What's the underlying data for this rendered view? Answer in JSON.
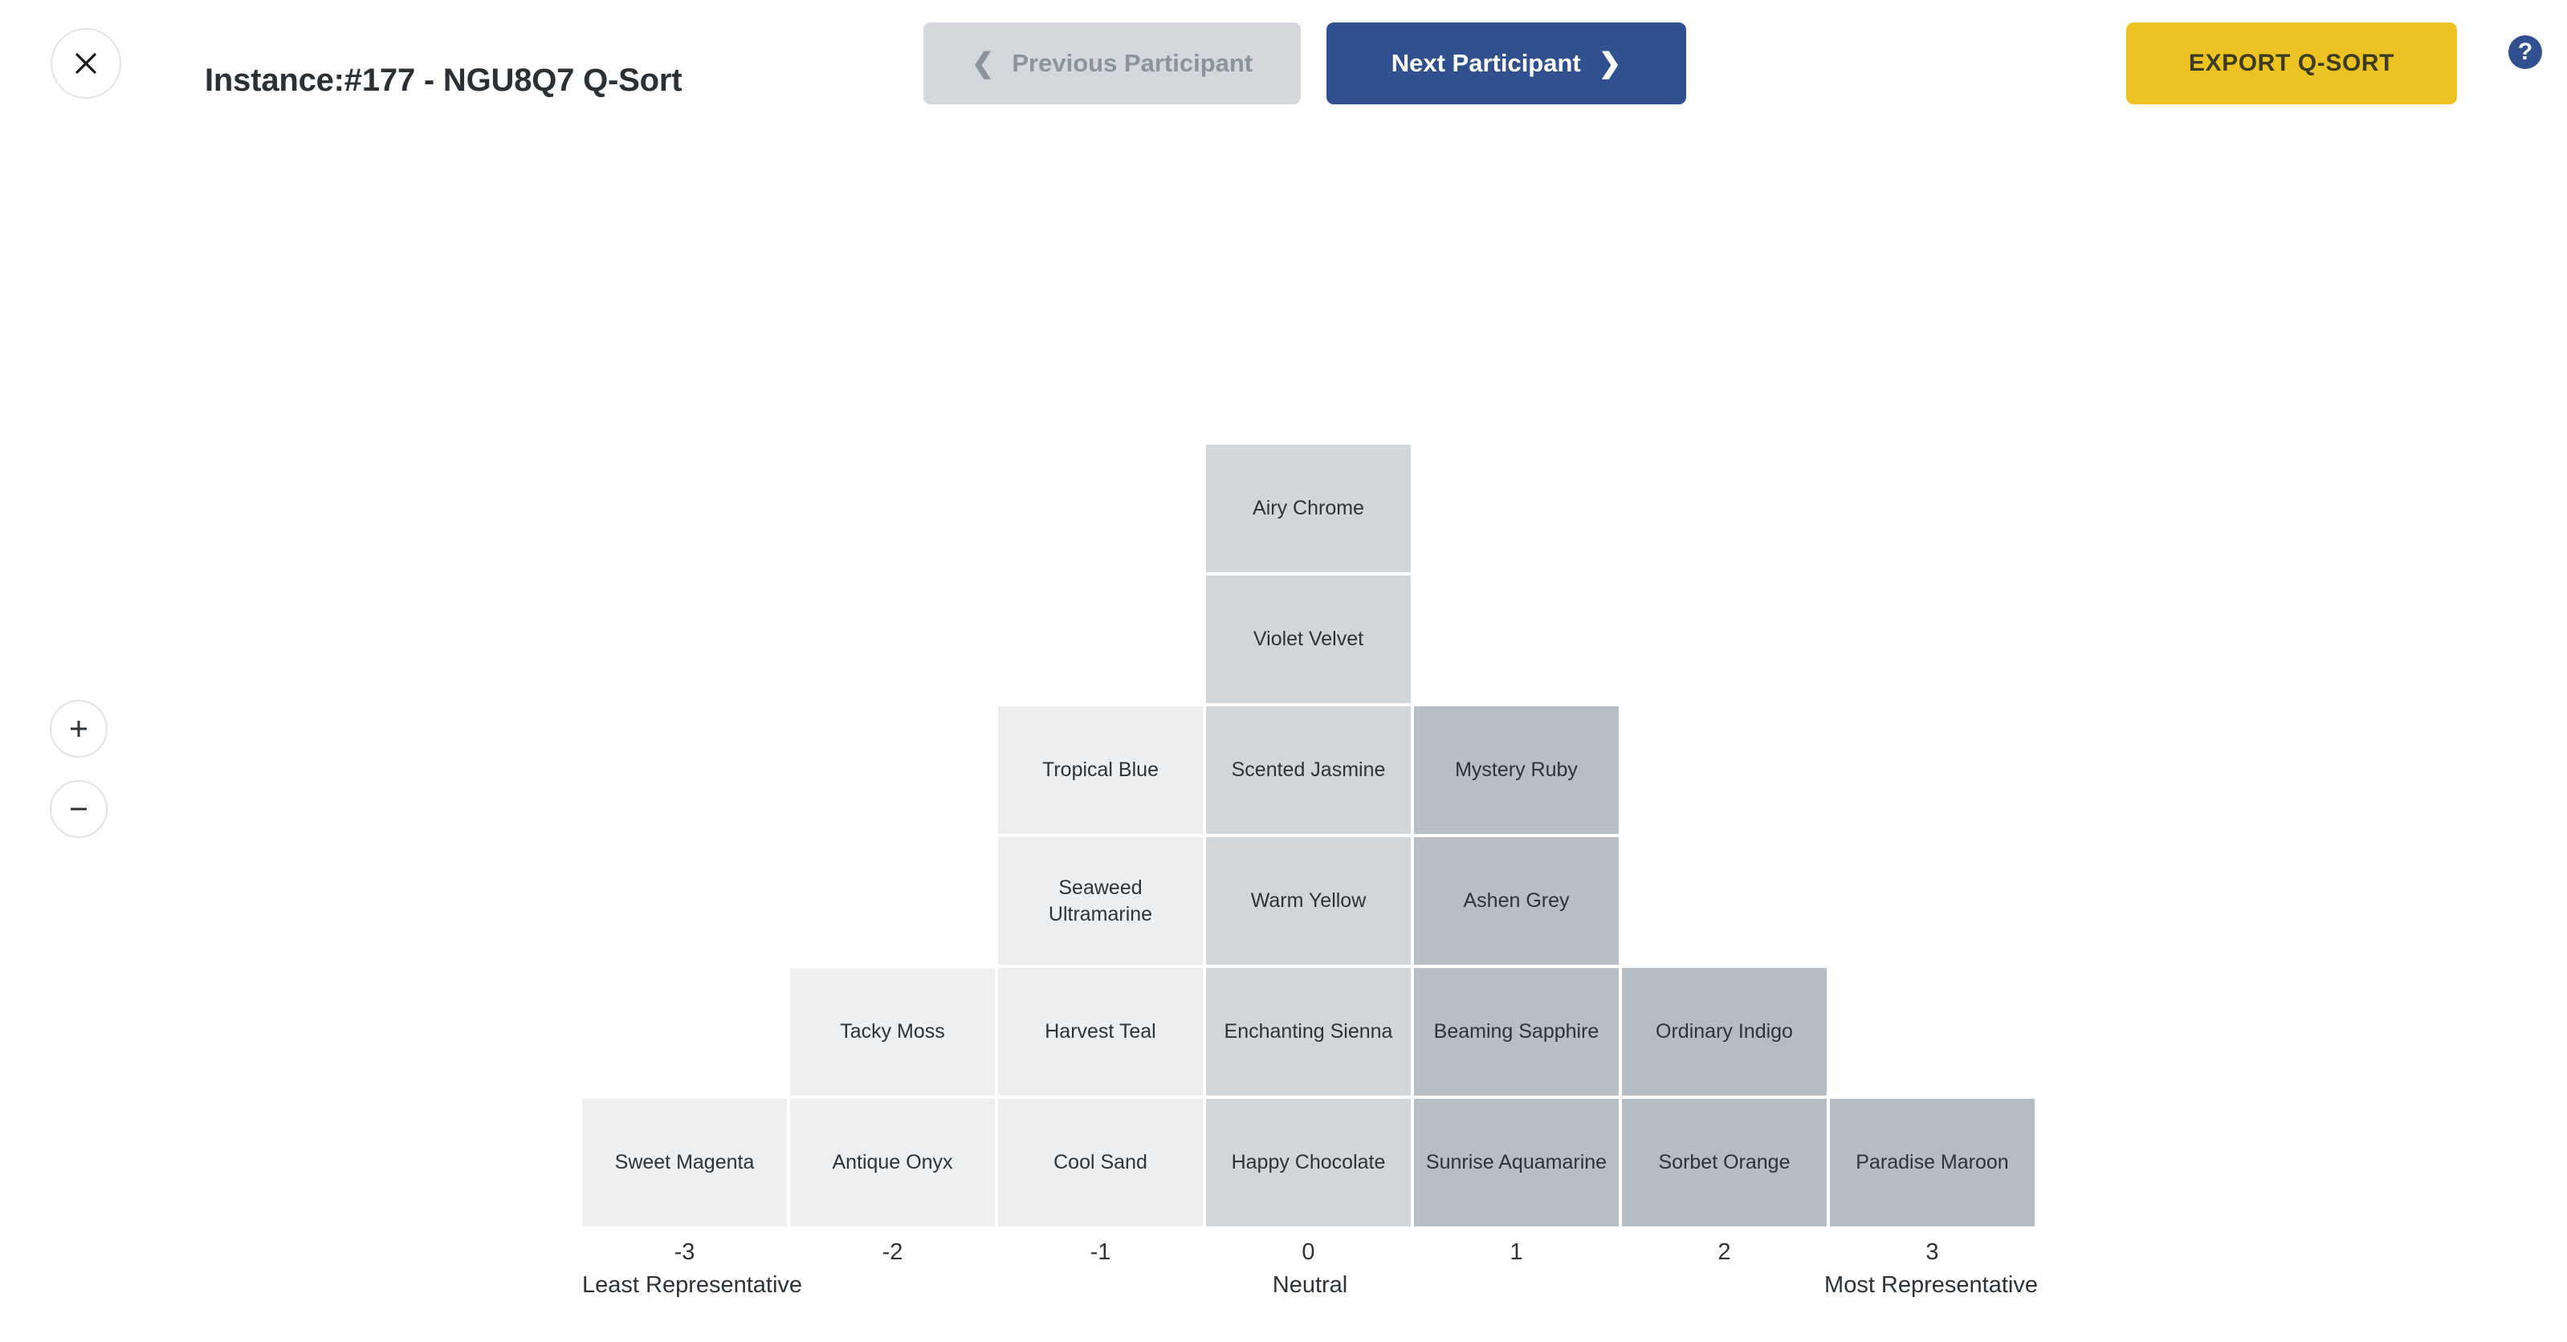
{
  "header": {
    "close_icon": "close-icon",
    "title": "Instance:#177 - NGU8Q7 Q-Sort",
    "previous_label": "Previous Participant",
    "previous_icon": "chevron-left-icon",
    "next_label": "Next Participant",
    "next_icon": "chevron-right-icon",
    "export_label": "EXPORT Q-SORT",
    "help_label": "?",
    "help_icon": "help-circle-icon",
    "accent_blue": "#31508f",
    "accent_yellow": "#edc324",
    "disabled_grey": "#d4d8dc"
  },
  "zoom_controls": {
    "zoom_in_icon": "plus-icon",
    "zoom_out_icon": "minus-icon"
  },
  "board": {
    "columns": [
      {
        "value": "-3",
        "color": "#eeeff0",
        "cards": [
          "Sweet Magenta"
        ]
      },
      {
        "value": "-2",
        "color": "#eeeff0",
        "cards": [
          "Tacky Moss",
          "Antique Onyx"
        ]
      },
      {
        "value": "-1",
        "color": "#eceeef",
        "cards": [
          "Tropical Blue",
          "Seaweed Ultramarine",
          "Harvest Teal",
          "Cool Sand"
        ]
      },
      {
        "value": "0",
        "color": "#d1d6da",
        "cards": [
          "Airy Chrome",
          "Violet Velvet",
          "Scented Jasmine",
          "Warm Yellow",
          "Enchanting Sienna",
          "Happy Chocolate"
        ]
      },
      {
        "value": "1",
        "color": "#b7bfc6",
        "cards": [
          "Mystery Ruby",
          "Ashen Grey",
          "Beaming Sapphire",
          "Sunrise Aquamarine"
        ]
      },
      {
        "value": "2",
        "color": "#b4bcc4",
        "cards": [
          "Ordinary Indigo",
          "Sorbet Orange"
        ]
      },
      {
        "value": "3",
        "color": "#b4bcc4",
        "cards": [
          "Paradise Maroon"
        ]
      }
    ],
    "legend": {
      "least": "Least Representative",
      "neutral": "Neutral",
      "most": "Most Representative"
    }
  }
}
